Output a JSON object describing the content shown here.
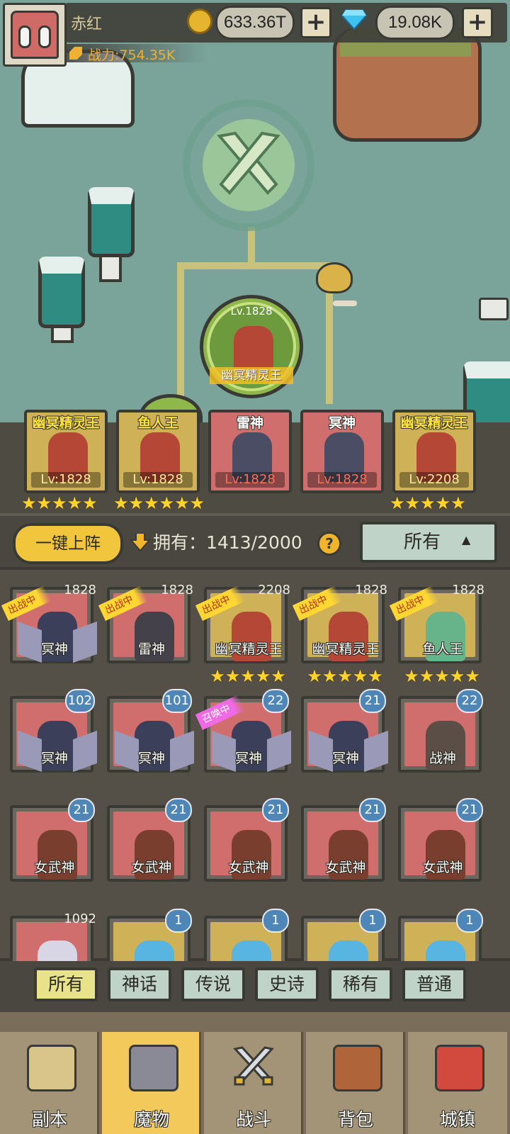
{
  "player": {
    "name": "赤红",
    "power": "战力:754.35K"
  },
  "currency": {
    "gold": "633.36T",
    "gems": "19.08K"
  },
  "map": {
    "boss_level": "Lv.1828",
    "boss_name": "幽冥精灵王"
  },
  "team": [
    {
      "name": "幽冥精灵王",
      "level": "Lv:1828",
      "stars": "★★★★★",
      "bg": "gold",
      "name_color": "yellow",
      "lv_color": "#ffe89a"
    },
    {
      "name": "鱼人王",
      "level": "Lv:1828",
      "stars": "★★★★★★★★★★",
      "bg": "gold",
      "name_color": "yellow",
      "lv_color": "#ffe89a"
    },
    {
      "name": "雷神",
      "level": "Lv:1828",
      "stars": "",
      "bg": "red",
      "name_color": "white",
      "lv_color": "#ff6b55"
    },
    {
      "name": "冥神",
      "level": "Lv:1828",
      "stars": "",
      "bg": "red",
      "name_color": "white",
      "lv_color": "#ff6b55"
    },
    {
      "name": "幽冥精灵王",
      "level": "Lv:2208",
      "stars": "★★★★★",
      "bg": "gold",
      "name_color": "yellow",
      "lv_color": "#ffe89a"
    }
  ],
  "controls": {
    "deploy_label": "一键上阵",
    "own_label": "拥有：1413/2000",
    "help": "?",
    "filter_value": "所有",
    "filter_arrow": "▲"
  },
  "monsters": [
    {
      "name": "冥神",
      "level": "1828",
      "tag": "出战中",
      "tag_type": "deploy",
      "bg": "red",
      "stars": ""
    },
    {
      "name": "雷神",
      "level": "1828",
      "tag": "出战中",
      "tag_type": "deploy",
      "bg": "red",
      "stars": ""
    },
    {
      "name": "幽冥精灵王",
      "level": "2208",
      "tag": "出战中",
      "tag_type": "deploy",
      "bg": "gold",
      "stars": "★★★★★"
    },
    {
      "name": "幽冥精灵王",
      "level": "1828",
      "tag": "出战中",
      "tag_type": "deploy",
      "bg": "gold",
      "stars": "★★★★★"
    },
    {
      "name": "鱼人王",
      "level": "1828",
      "tag": "出战中",
      "tag_type": "deploy",
      "bg": "gold",
      "stars": "★★★★★"
    },
    {
      "name": "冥神",
      "level": "102",
      "tag": "",
      "tag_type": "",
      "bg": "red",
      "stars": ""
    },
    {
      "name": "冥神",
      "level": "101",
      "tag": "",
      "tag_type": "",
      "bg": "red",
      "stars": ""
    },
    {
      "name": "冥神",
      "level": "22",
      "tag": "召唤中",
      "tag_type": "summon",
      "bg": "red",
      "stars": ""
    },
    {
      "name": "冥神",
      "level": "21",
      "tag": "",
      "tag_type": "",
      "bg": "red",
      "stars": ""
    },
    {
      "name": "战神",
      "level": "22",
      "tag": "",
      "tag_type": "",
      "bg": "red",
      "stars": ""
    },
    {
      "name": "女武神",
      "level": "21",
      "tag": "",
      "tag_type": "",
      "bg": "red",
      "stars": ""
    },
    {
      "name": "女武神",
      "level": "21",
      "tag": "",
      "tag_type": "",
      "bg": "red",
      "stars": ""
    },
    {
      "name": "女武神",
      "level": "21",
      "tag": "",
      "tag_type": "",
      "bg": "red",
      "stars": ""
    },
    {
      "name": "女武神",
      "level": "21",
      "tag": "",
      "tag_type": "",
      "bg": "red",
      "stars": ""
    },
    {
      "name": "女武神",
      "level": "21",
      "tag": "",
      "tag_type": "",
      "bg": "red",
      "stars": ""
    },
    {
      "name": "",
      "level": "1092",
      "tag": "",
      "tag_type": "",
      "bg": "red",
      "stars": ""
    },
    {
      "name": "",
      "level": "1",
      "tag": "",
      "tag_type": "",
      "bg": "gold",
      "stars": ""
    },
    {
      "name": "",
      "level": "1",
      "tag": "",
      "tag_type": "",
      "bg": "gold",
      "stars": ""
    },
    {
      "name": "",
      "level": "1",
      "tag": "",
      "tag_type": "",
      "bg": "gold",
      "stars": ""
    },
    {
      "name": "",
      "level": "1",
      "tag": "",
      "tag_type": "",
      "bg": "gold",
      "stars": ""
    }
  ],
  "rarity_tabs": [
    "所有",
    "神话",
    "传说",
    "史诗",
    "稀有",
    "普通"
  ],
  "nav": [
    {
      "label": "副本",
      "icon": "map-icon"
    },
    {
      "label": "魔物",
      "icon": "monster-helmet-icon"
    },
    {
      "label": "战斗",
      "icon": "crossed-swords-icon"
    },
    {
      "label": "背包",
      "icon": "backpack-icon"
    },
    {
      "label": "城镇",
      "icon": "shop-icon"
    }
  ],
  "colors": {
    "gold_card": "#cfb258",
    "red_card": "#cf6e6c",
    "active_nav": "#f3c95c",
    "level_badge": "#4e86b8"
  }
}
